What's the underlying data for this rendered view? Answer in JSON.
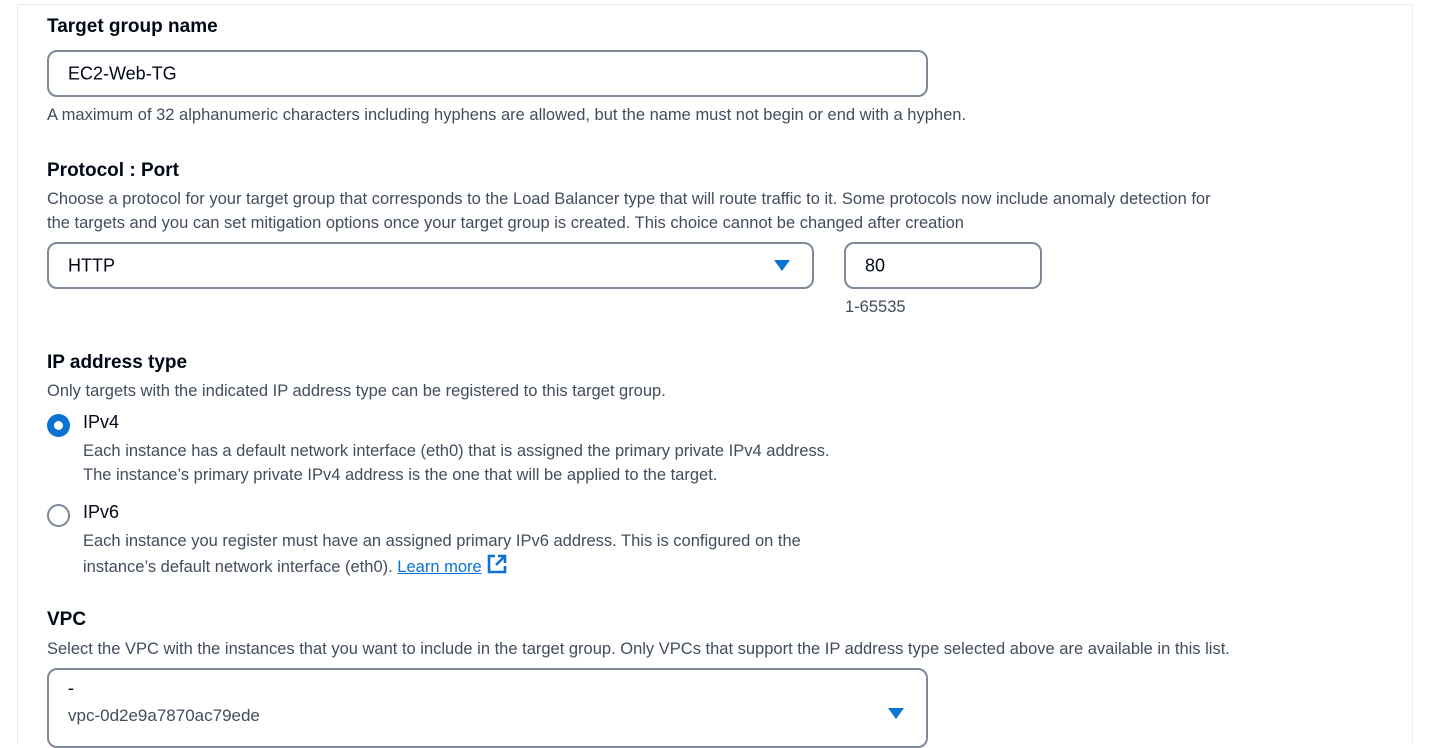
{
  "target_group_name": {
    "label": "Target group name",
    "value": "EC2-Web-TG",
    "hint": "A maximum of 32 alphanumeric characters including hyphens are allowed, but the name must not begin or end with a hyphen."
  },
  "protocol_port": {
    "label": "Protocol : Port",
    "description_line1": "Choose a protocol for your target group that corresponds to the Load Balancer type that will route traffic to it. Some protocols now include anomaly detection for",
    "description_line2": "the targets and you can set mitigation options once your target group is created. This choice cannot be changed after creation",
    "protocol_value": "HTTP",
    "port_value": "80",
    "port_hint": "1-65535"
  },
  "ip_address_type": {
    "label": "IP address type",
    "description": "Only targets with the indicated IP address type can be registered to this target group.",
    "options": [
      {
        "label": "IPv4",
        "selected": true,
        "desc_line1": "Each instance has a default network interface (eth0) that is assigned the primary private IPv4 address.",
        "desc_line2": "The instance’s primary private IPv4 address is the one that will be applied to the target."
      },
      {
        "label": "IPv6",
        "selected": false,
        "desc_line1": "Each instance you register must have an assigned primary IPv6 address. This is configured on the",
        "desc_line2": "instance’s default network interface (eth0).",
        "link_text": "Learn more"
      }
    ]
  },
  "vpc": {
    "label": "VPC",
    "description": "Select the VPC with the instances that you want to include in the target group. Only VPCs that support the IP address type selected above are available in this list.",
    "selected_name": "-",
    "selected_id": "vpc-0d2e9a7870ac79ede"
  },
  "colors": {
    "accent": "#0972d3",
    "text": "#000716",
    "secondary_text": "#414d5c",
    "border": "#7d8998"
  }
}
